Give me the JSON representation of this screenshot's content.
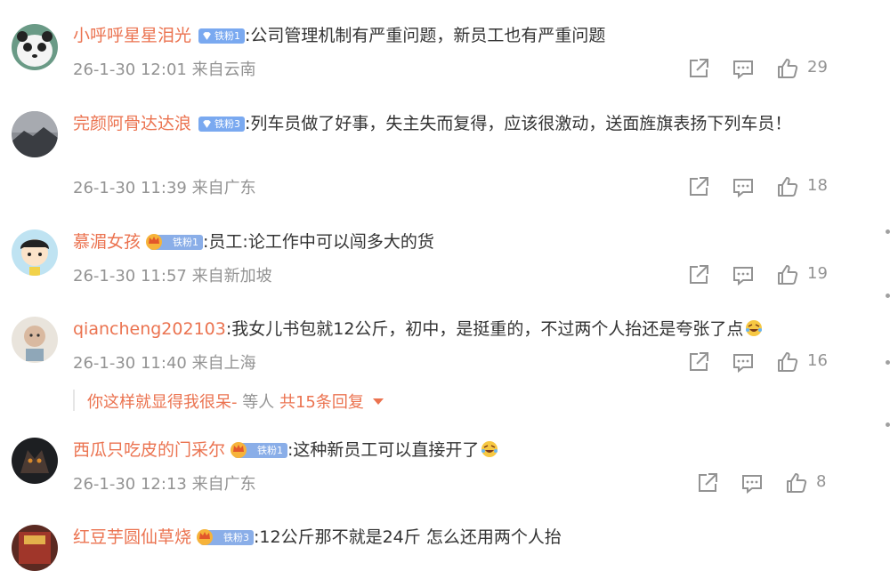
{
  "comments": [
    {
      "username": "小呼呼星星泪光",
      "badge": "铁粉1",
      "text": "公司管理机制有严重问题，新员工也有严重问题",
      "time": "26-1-30 12:01",
      "location": "来自云南",
      "likes": "29"
    },
    {
      "username": "完颜阿骨达达浪",
      "badge": "铁粉3",
      "text": "列车员做了好事，失主失而复得，应该很激动，送面旌旗表扬下列车员！",
      "time": "26-1-30 11:39",
      "location": "来自广东",
      "likes": "18"
    },
    {
      "username": "慕湄女孩",
      "badge": "铁粉1",
      "text": "员工:论工作中可以闯多大的货",
      "time": "26-1-30 11:57",
      "location": "来自新加坡",
      "likes": "19"
    },
    {
      "username": "qiancheng202103",
      "badge": "",
      "text": "我女儿书包就12公斤，初中，是挺重的，不过两个人抬还是夸张了点",
      "time": "26-1-30 11:40",
      "location": "来自上海",
      "likes": "16",
      "reply": {
        "author": "你这样就显得我很呆-",
        "middle": "等人",
        "count": "共15条回复"
      }
    },
    {
      "username": "西瓜只吃皮的门采尔",
      "badge": "铁粉1",
      "text": "这种新员工可以直接开了",
      "time": "26-1-30 12:13",
      "location": "来自广东",
      "likes": "8"
    },
    {
      "username": "红豆芋圆仙草烧",
      "badge": "铁粉3",
      "text": "12公斤那不就是24斤 怎么还用两个人抬",
      "time": "",
      "location": "",
      "likes": ""
    }
  ],
  "icons": {
    "share": "share-icon",
    "comment": "comment-icon",
    "like": "thumbs-up-icon"
  },
  "colors": {
    "username": "#eb7350",
    "meta": "#939393",
    "badge": "#7aa9f0"
  }
}
